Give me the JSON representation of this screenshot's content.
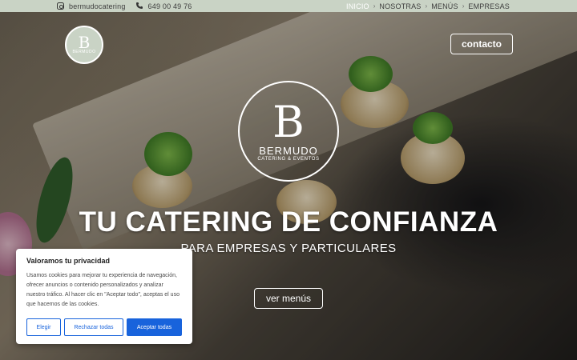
{
  "topbar": {
    "instagram_handle": "bermudocatering",
    "phone": "649 00 49 76",
    "nav": [
      {
        "label": "INICIO",
        "active": true
      },
      {
        "label": "NOSOTRAS",
        "active": false
      },
      {
        "label": "MENÚS",
        "active": false
      },
      {
        "label": "EMPRESAS",
        "active": false
      }
    ]
  },
  "header": {
    "logo_letter": "B",
    "logo_small_text": "BERMUDO",
    "contact_label": "contacto"
  },
  "hero": {
    "logo_letter": "B",
    "logo_name": "BERMUDO",
    "logo_tagline": "CATERING & EVENTOS",
    "headline": "TU CATERING DE CONFIANZA",
    "subheadline": "PARA EMPRESAS Y PARTICULARES",
    "cta_label": "ver menús"
  },
  "cookie": {
    "title": "Valoramos tu privacidad",
    "body": "Usamos cookies para mejorar tu experiencia de navegación, ofrecer anuncios o contenido personalizados y analizar nuestro tráfico. Al hacer clic en \"Aceptar todo\", aceptas el uso que hacemos de las cookies.",
    "btn_customize": "Elegir",
    "btn_reject": "Rechazar todas",
    "btn_accept": "Aceptar todas"
  },
  "colors": {
    "topbar_bg": "#c9d3c5",
    "accent_blue": "#1863dc"
  },
  "icons": [
    "instagram-icon",
    "phone-icon"
  ]
}
